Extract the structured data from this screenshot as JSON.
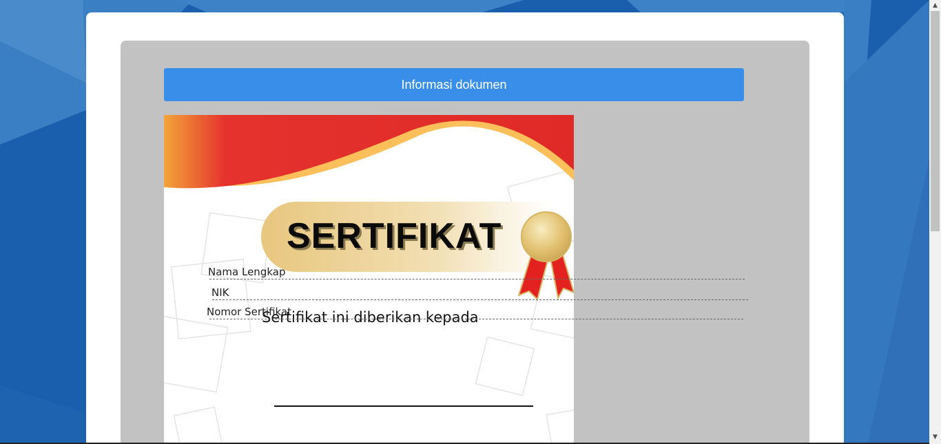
{
  "page": {
    "background_color": "#1a5fae",
    "accent_color": "#388ee9"
  },
  "viewer": {
    "info_button_label": "Informasi dokumen"
  },
  "certificate": {
    "title": "SERTIFIKAT",
    "subtitle": "Sertifikat ini diberikan kepada",
    "badge_icon": "medal-ribbon-icon"
  },
  "fields": {
    "full_name_label": "Nama Lengkap",
    "nik_label": "NIK",
    "certificate_number_label": "Nomor Sertifikat"
  },
  "scrollbar": {
    "up_icon": "▲",
    "down_icon": "▼"
  }
}
